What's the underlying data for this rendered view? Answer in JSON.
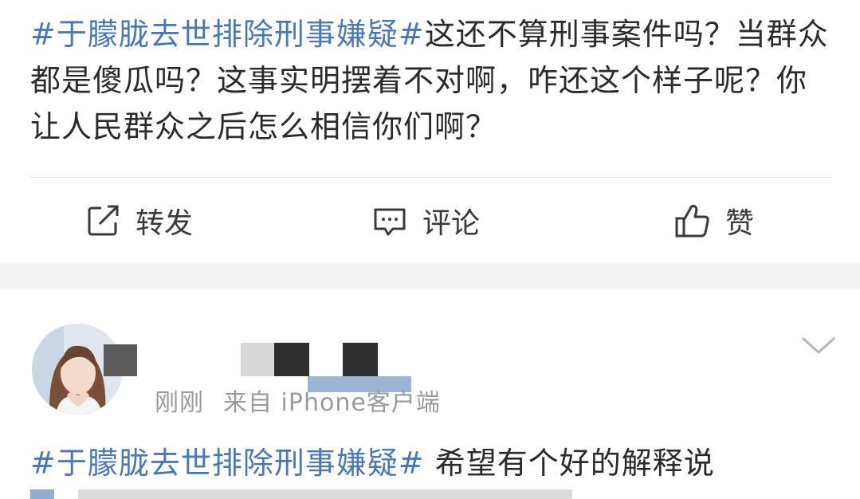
{
  "post": {
    "hashtag": "#于朦胧去世排除刑事嫌疑#",
    "body": "这还不算刑事案件吗？当群众都是傻瓜吗？这事实明摆着不对啊，咋还这个样子呢？你让人民群众之后怎么相信你们啊？"
  },
  "actions": {
    "repost": "转发",
    "comment": "评论",
    "like": "赞"
  },
  "comment": {
    "time": "刚刚",
    "source": "来自 iPhone客户端",
    "hashtag": "#于朦胧去世排除刑事嫌疑#",
    "body": " 希望有个好的解释说"
  },
  "colors": {
    "hashtag": "#4a78b5",
    "text": "#2b2b2b",
    "meta": "#9a9a9a",
    "separator": "#f2f2f2"
  }
}
